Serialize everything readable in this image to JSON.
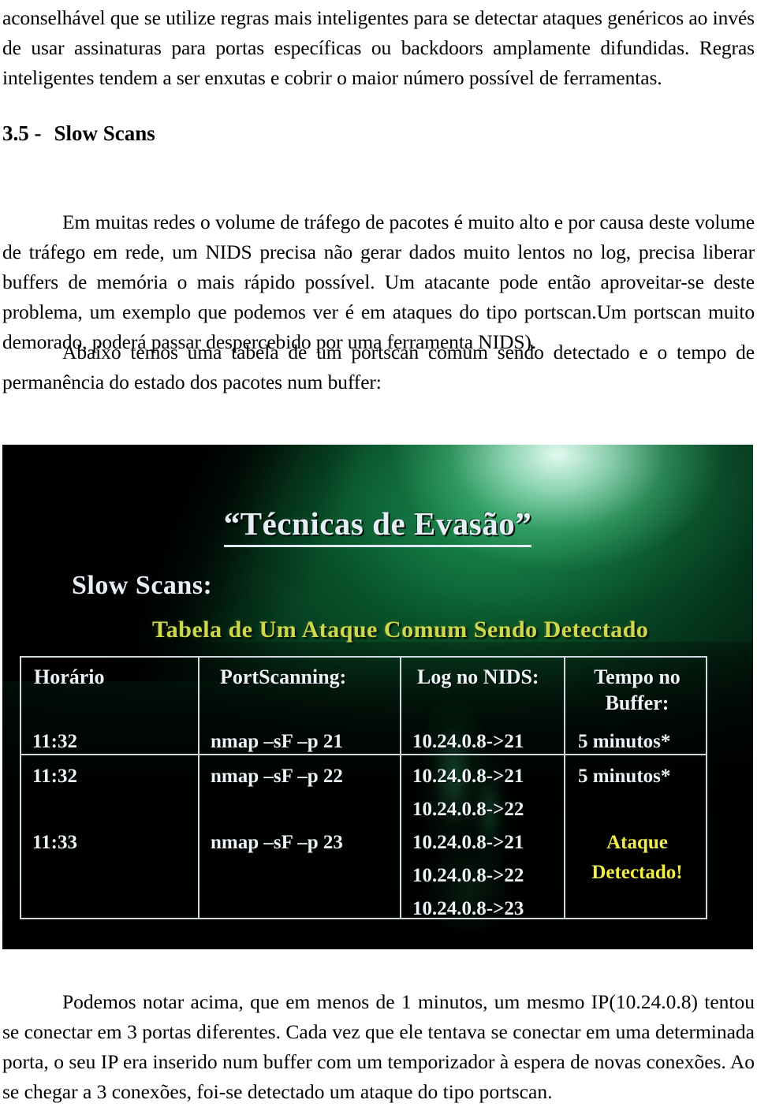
{
  "document": {
    "paragraph_top": "aconselhável que se utilize regras mais inteligentes para se detectar ataques genéricos ao invés de usar assinaturas para portas específicas ou backdoors amplamente difundidas. Regras inteligentes tendem a ser enxutas e cobrir o maior número possível de ferramentas.",
    "heading": {
      "number": "3.5 -",
      "title": "Slow Scans"
    },
    "paragraph_body": "Em muitas redes o volume de tráfego de pacotes é muito alto e por causa deste volume de tráfego em rede, um NIDS precisa não gerar dados muito lentos no log, precisa liberar buffers de memória o mais rápido possível. Um atacante pode então aproveitar-se deste problema, um exemplo que podemos ver é em ataques do tipo portscan.Um portscan muito demorado, poderá passar despercebido por uma ferramenta NIDS).",
    "paragraph_intro_table": "Abaixo temos uma tabela de um portscan comum sendo detectado e o tempo de permanência do estado dos pacotes num buffer:",
    "paragraph_bottom": "Podemos notar acima, que em menos de 1 minutos, um mesmo IP(10.24.0.8) tentou se conectar em 3 portas diferentes. Cada vez que ele tentava se conectar em uma determinada porta, o seu IP era inserido num buffer com um temporizador à espera de novas conexões. Ao se chegar a 3 conexões, foi-se detectado um ataque do tipo portscan."
  },
  "slide": {
    "title": "“Técnicas de Evasão”",
    "subtitle_1": "Slow Scans:",
    "subtitle_2": "Tabela de Um Ataque Comum Sendo Detectado",
    "colors": {
      "background_dark": "#000301",
      "glow_green": "#1fa463",
      "glow_highlight": "#e8fff6",
      "title_text": "#e6eef5",
      "subtitle_2_text": "#ccd94e",
      "alert_text": "#f2ef4b",
      "table_border": "#cfd8dd"
    },
    "table": {
      "headers": [
        "Horário",
        "PortScanning:",
        "Log no NIDS:",
        "Tempo no Buffer:"
      ],
      "rows": [
        {
          "horario": "11:32",
          "portscanning": "nmap –sF –p 21",
          "log": [
            "10.24.0.8->21"
          ],
          "buffer": "5 minutos*",
          "buffer_alert": false
        },
        {
          "horario": "11:32",
          "portscanning": "nmap –sF –p 22",
          "log": [
            "10.24.0.8->21",
            "10.24.0.8->22"
          ],
          "buffer": "5 minutos*",
          "buffer_alert": false
        },
        {
          "horario": "11:33",
          "portscanning": "nmap –sF –p 23",
          "log": [
            "10.24.0.8->21",
            "10.24.0.8->22",
            "10.24.0.8->23"
          ],
          "buffer": "Ataque Detectado!",
          "buffer_line1": "Ataque",
          "buffer_line2": "Detectado!",
          "buffer_alert": true
        }
      ]
    }
  }
}
